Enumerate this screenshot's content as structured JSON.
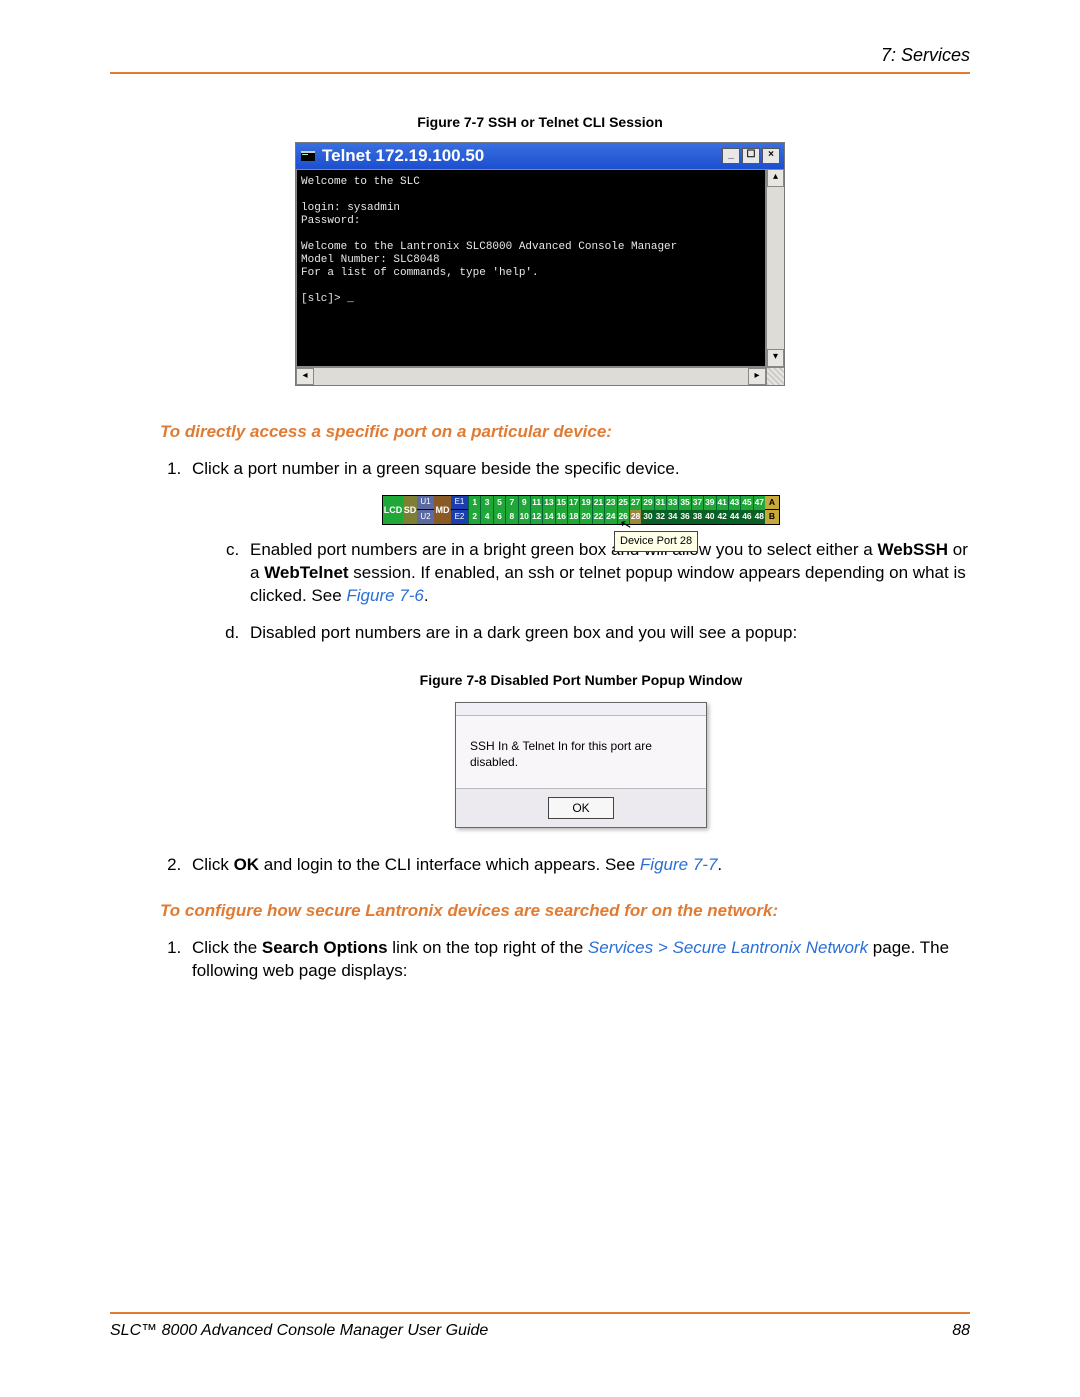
{
  "header": {
    "chapter": "7: Services"
  },
  "figure77": {
    "caption": "Figure 7-7  SSH or Telnet CLI Session",
    "title": "Telnet 172.19.100.50",
    "sysbtns": {
      "min": "_",
      "max": "☐",
      "close": "×"
    },
    "body": "Welcome to the SLC\n\nlogin: sysadmin\nPassword:\n\nWelcome to the Lantronix SLC8000 Advanced Console Manager\nModel Number: SLC8048\nFor a list of commands, type 'help'.\n\n[slc]> _"
  },
  "subheading1": "To directly access a specific port on a particular device:",
  "step1": {
    "text": "Click a port number in a green square beside the specific device."
  },
  "port_strip": {
    "labels": {
      "lcd": "LCD",
      "sd": "SD",
      "u1": "U1",
      "u2": "U2",
      "md": "MD",
      "e1": "E1",
      "e2": "E2",
      "a": "A",
      "b": "B"
    },
    "top_ports": [
      1,
      3,
      5,
      7,
      9,
      11,
      13,
      15,
      17,
      19,
      21,
      23,
      25,
      27,
      29,
      31,
      33,
      35,
      37,
      39,
      41,
      43,
      45,
      47
    ],
    "bottom_ports": [
      2,
      4,
      6,
      8,
      10,
      12,
      14,
      16,
      18,
      20,
      22,
      24,
      26,
      28,
      30,
      32,
      34,
      36,
      38,
      40,
      42,
      44,
      46,
      48
    ],
    "hover_index_bottom": 13,
    "dark_from_bottom_index": 14,
    "tooltip": "Device Port 28"
  },
  "sub_c": {
    "prefix": "Enabled port numbers are in a bright green box and will allow you to select either a ",
    "webssh": "WebSSH",
    "mid": " or a ",
    "webtelnet": "WebTelnet",
    "rest": " session.  If enabled, an ssh or telnet popup window appears depending on what is clicked.  See ",
    "link": "Figure 7-6",
    "end": "."
  },
  "sub_d": "Disabled port numbers are in a dark green box and you will see a popup:",
  "figure78": {
    "caption": "Figure 7-8  Disabled Port Number Popup Window",
    "message": "SSH In & Telnet In for this port are disabled.",
    "ok": "OK"
  },
  "step2": {
    "pre": "Click ",
    "ok": "OK",
    "mid": " and login to the CLI interface which appears.   See ",
    "link": "Figure 7-7",
    "end": "."
  },
  "subheading2": "To configure how secure Lantronix devices are searched for on the network:",
  "step3": {
    "pre": "Click the ",
    "so": "Search Options",
    "mid": " link on the top right of the ",
    "link": "Services > Secure Lantronix Network",
    "end": " page. The following web page displays:"
  },
  "footer": {
    "title": "SLC™ 8000 Advanced Console Manager User Guide",
    "page": "88"
  }
}
